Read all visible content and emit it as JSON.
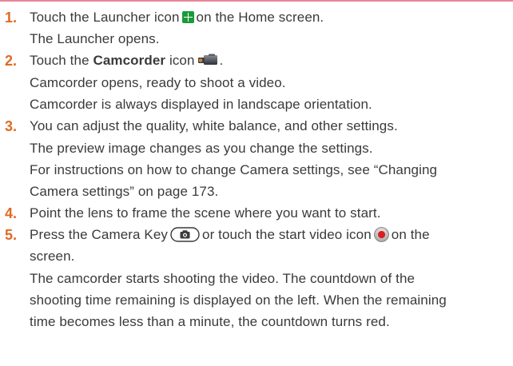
{
  "steps": [
    {
      "number": "1.",
      "before_icon": "Touch the Launcher icon",
      "icon": "launcher-icon",
      "after_icon": "on the Home screen.",
      "details": [
        "The Launcher opens."
      ]
    },
    {
      "number": "2.",
      "prefix": "Touch the",
      "bold": "Camcorder",
      "suffix": "icon",
      "icon": "camcorder-icon",
      "end": ".",
      "details": [
        "Camcorder opens, ready to shoot a video.",
        "Camcorder is always displayed in landscape orientation."
      ]
    },
    {
      "number": "3.",
      "text": "You can adjust the quality, white balance, and other settings.",
      "details": [
        "The preview image changes as you change the settings.",
        "For instructions on how to change Camera settings, see “Changing",
        "Camera settings” on page 173."
      ]
    },
    {
      "number": "4.",
      "text": "Point the lens to frame the scene where you want to start."
    },
    {
      "number": "5.",
      "part1": "Press the Camera Key",
      "icon1": "camera-key-icon",
      "part2": "or touch the start video icon",
      "icon2": "record-icon",
      "part3": "on the",
      "continuation": "screen.",
      "details": [
        "The camcorder starts shooting the video. The countdown of the",
        "shooting time remaining is displayed on the left. When the remaining",
        "time becomes less than a minute, the countdown turns red."
      ]
    }
  ],
  "colors": {
    "step_number": "#e06a24",
    "top_rule": "#e8869a",
    "body_text": "#3a3a3a",
    "launcher_icon": "#1a9a38",
    "record_dot": "#d8201c"
  }
}
